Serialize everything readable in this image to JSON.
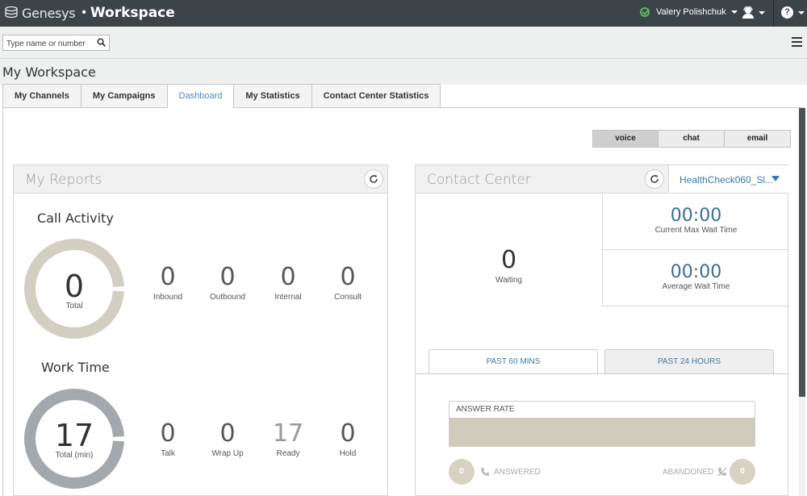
{
  "app": {
    "brand": "Genesys",
    "separator": "•",
    "product": "Workspace"
  },
  "user": {
    "name": "Valery Polishchuk",
    "status": "ready",
    "status_color": "#5cb85c"
  },
  "topbar_icons": {
    "agent": "agent-icon",
    "help": "?"
  },
  "search": {
    "placeholder": "Type name or number"
  },
  "workspace": {
    "title": "My Workspace"
  },
  "tabs": [
    {
      "label": "My Channels",
      "active": false
    },
    {
      "label": "My Campaigns",
      "active": false
    },
    {
      "label": "Dashboard",
      "active": true
    },
    {
      "label": "My Statistics",
      "active": false
    },
    {
      "label": "Contact Center Statistics",
      "active": false
    }
  ],
  "media": {
    "options": [
      "voice",
      "chat",
      "email"
    ],
    "selected": "voice"
  },
  "my_reports": {
    "title": "My Reports",
    "call_activity": {
      "title": "Call Activity",
      "total_value": "0",
      "total_label": "Total",
      "metrics": [
        {
          "value": "0",
          "label": "Inbound"
        },
        {
          "value": "0",
          "label": "Outbound"
        },
        {
          "value": "0",
          "label": "Internal"
        },
        {
          "value": "0",
          "label": "Consult"
        }
      ]
    },
    "work_time": {
      "title": "Work Time",
      "total_value": "17",
      "total_label": "Total (min)",
      "metrics": [
        {
          "value": "0",
          "label": "Talk"
        },
        {
          "value": "0",
          "label": "Wrap Up"
        },
        {
          "value": "17",
          "label": "Ready"
        },
        {
          "value": "0",
          "label": "Hold"
        }
      ]
    }
  },
  "contact_center": {
    "title": "Contact Center",
    "queue": "HealthCheck060_Sl...",
    "waiting_value": "0",
    "waiting_label": "Waiting",
    "max_wait_value": "00:00",
    "max_wait_label": "Current Max Wait Time",
    "avg_wait_value": "00:00",
    "avg_wait_label": "Average Wait Time",
    "range_tabs": [
      "PAST 60 MINS",
      "PAST 24 HOURS"
    ],
    "answer_rate_label": "ANSWER RATE",
    "answered_value": "0",
    "answered_label": "ANSWERED",
    "abandoned_value": "0",
    "abandoned_label": "ABANDONED"
  },
  "colors": {
    "topbar": "#3d4448",
    "accent": "#4a8ac0",
    "donut_call": "#d2cec1",
    "donut_work": "#a2a8ad",
    "answer_bar": "#cfcbbd"
  }
}
